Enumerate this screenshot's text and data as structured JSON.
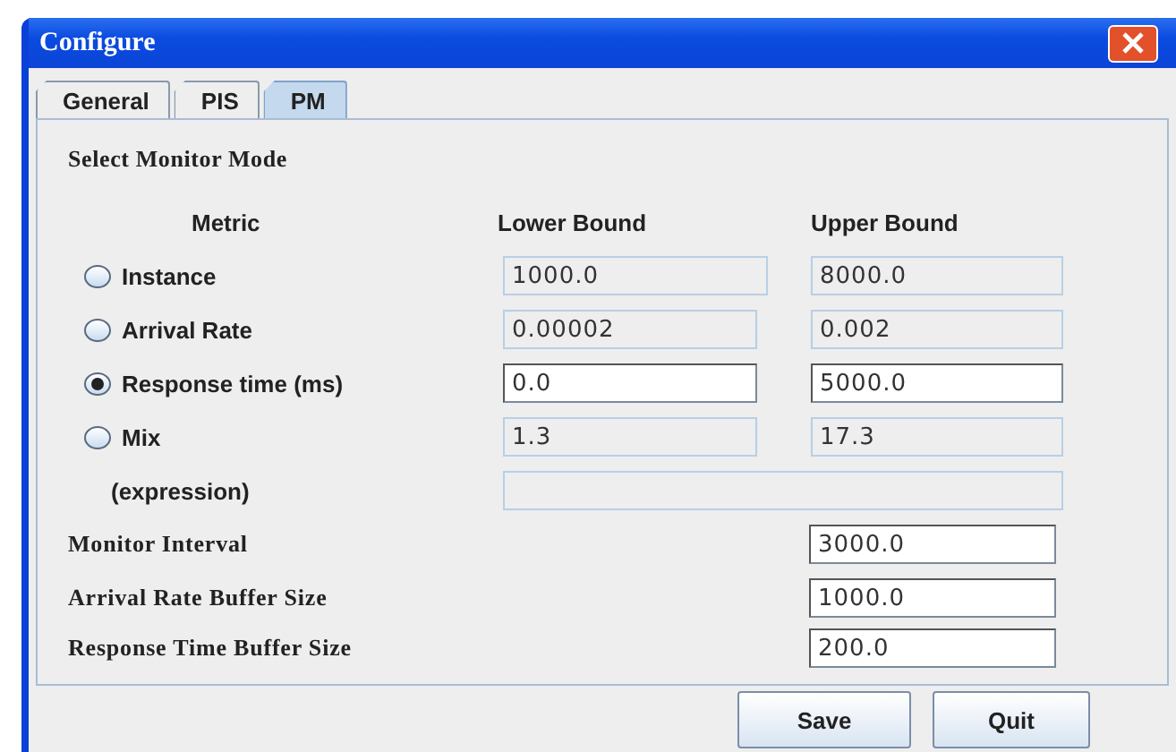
{
  "window": {
    "title": "Configure"
  },
  "tabs": [
    {
      "label": "General",
      "selected": false
    },
    {
      "label": "PIS",
      "selected": false
    },
    {
      "label": "PM",
      "selected": true
    }
  ],
  "section_title": "Select Monitor Mode",
  "columns": [
    "Metric",
    "Lower Bound",
    "Upper Bound"
  ],
  "metrics": [
    {
      "label": "Instance",
      "selected": false,
      "lower": {
        "value": "1000.0",
        "disabled": true
      },
      "upper": {
        "value": "8000.0",
        "disabled": true
      }
    },
    {
      "label": "Arrival Rate",
      "selected": false,
      "lower": {
        "value": "0.00002",
        "disabled": true
      },
      "upper": {
        "value": "0.002",
        "disabled": true
      }
    },
    {
      "label": "Response time (ms)",
      "selected": true,
      "lower": {
        "value": "0.0",
        "disabled": false
      },
      "upper": {
        "value": "5000.0",
        "disabled": false
      }
    },
    {
      "label": "Mix",
      "selected": false,
      "lower": {
        "value": "1.3",
        "disabled": true
      },
      "upper": {
        "value": "17.3",
        "disabled": true
      }
    }
  ],
  "expression": {
    "label": "(expression)",
    "field": {
      "disabled": true
    }
  },
  "settings": [
    {
      "label": "Monitor Interval",
      "value": "3000.0"
    },
    {
      "label": "Arrival Rate Buffer Size",
      "value": "1000.0"
    },
    {
      "label": "Response Time Buffer Size",
      "value": "200.0"
    }
  ],
  "buttons": [
    "Save",
    "Quit"
  ]
}
